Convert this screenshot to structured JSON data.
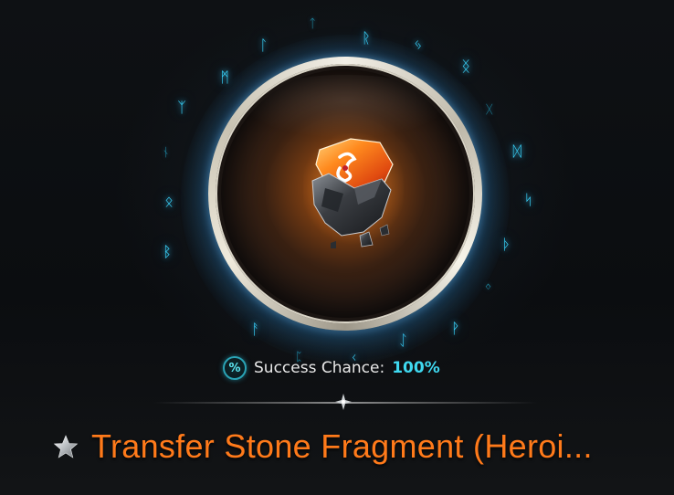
{
  "item": {
    "name": "Transfer Stone Fragment (Heroi...",
    "rarity_color": "#ff7a1a",
    "icon": "transfer-stone-fragment-icon"
  },
  "success": {
    "label": "Success Chance:",
    "value": "100%",
    "value_fraction": 1.0,
    "icon_glyph": "%",
    "value_color": "#3fd9f0"
  },
  "decor": {
    "rune_color": "#3ad7ff",
    "rune_glyphs": [
      "ᛒ",
      "ᛟ",
      "ᚾ",
      "ᛉ",
      "ᛗ",
      "ᛚ",
      "ᛏ",
      "ᚱ",
      "ᛃ",
      "ᛝ",
      "ᚷ",
      "ᛞ",
      "ᛋ",
      "ᚦ",
      "ᛜ",
      "ᚹ",
      "ᛇ",
      "ᚲ",
      "ᛈ",
      "ᚨ"
    ],
    "star_icon": "star-icon",
    "divider_gem_icon": "divider-gem-icon"
  }
}
